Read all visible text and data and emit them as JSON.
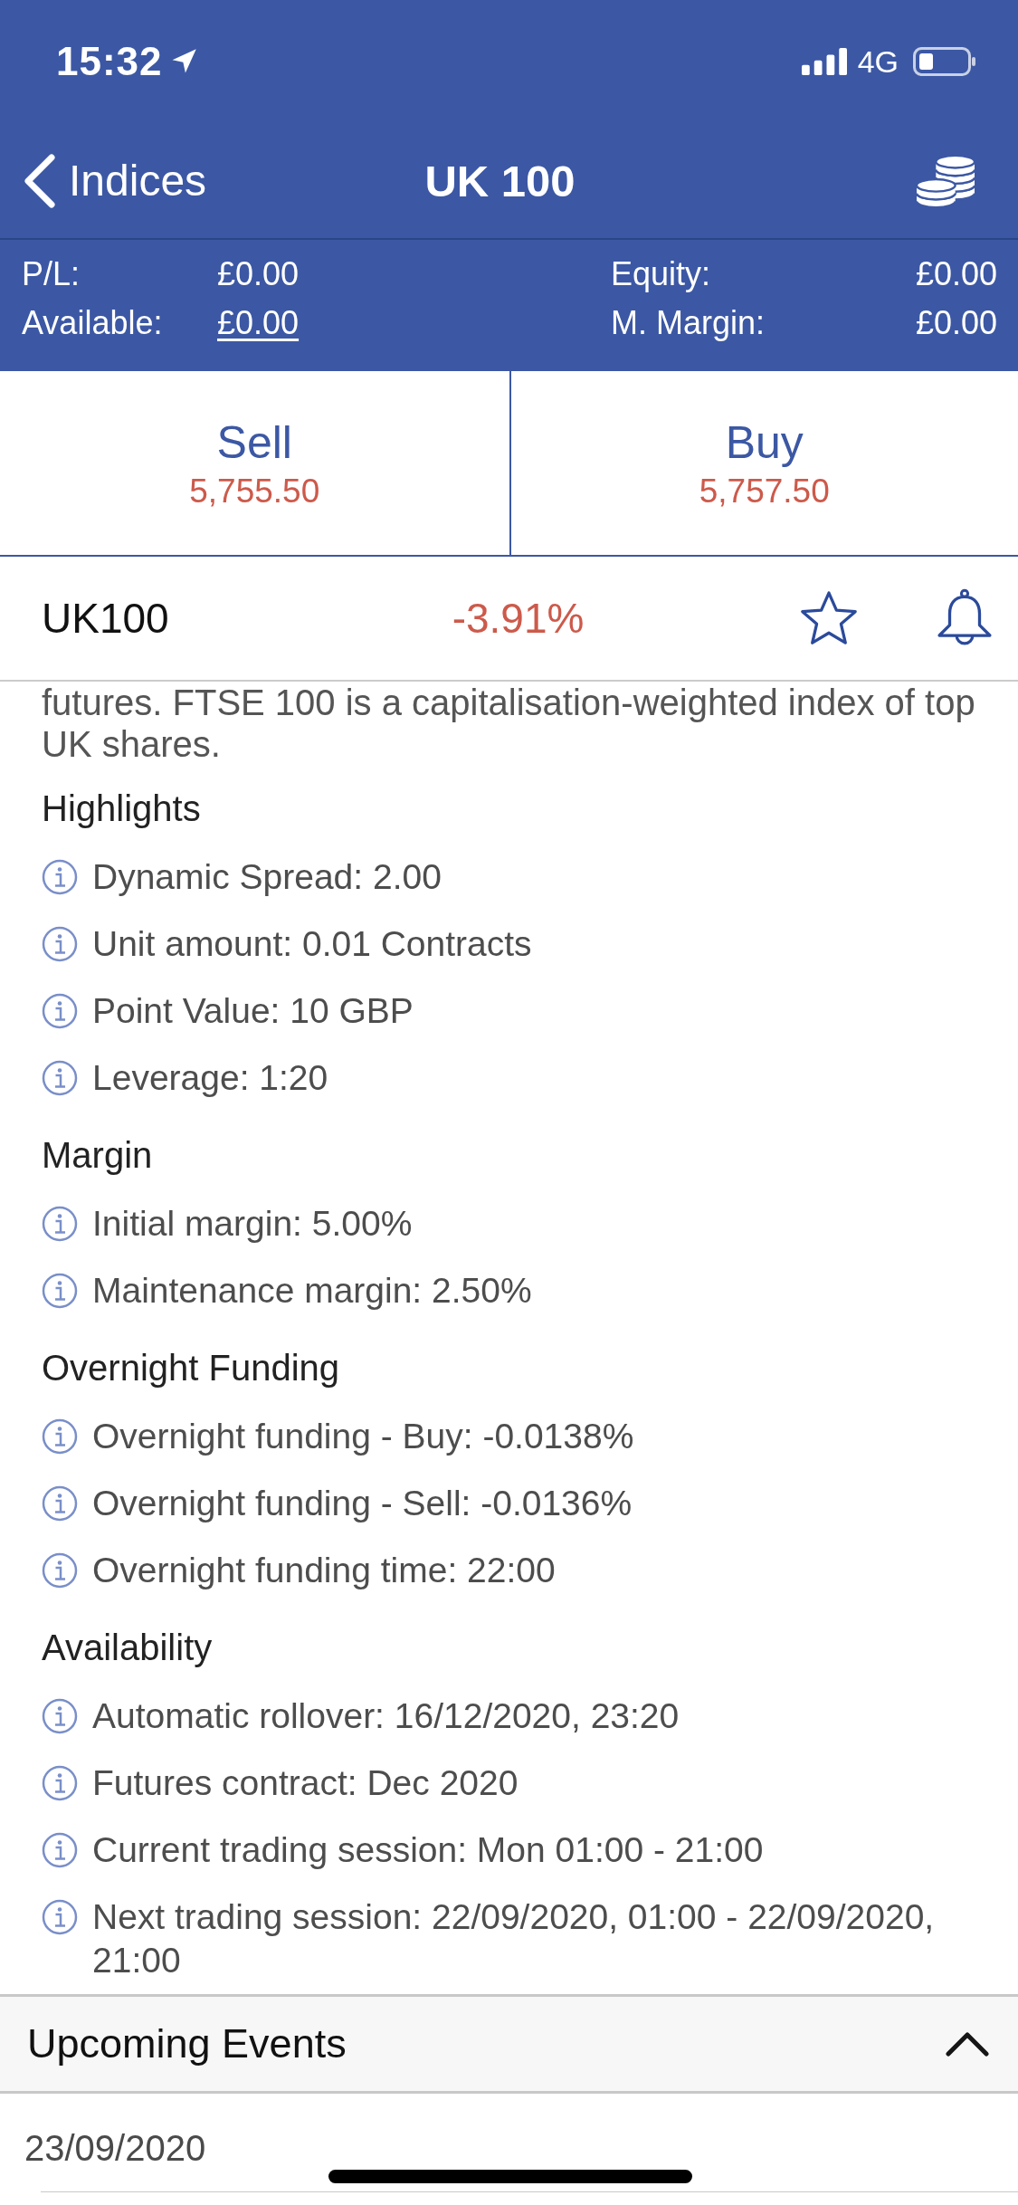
{
  "status_bar": {
    "time": "15:32",
    "network": "4G"
  },
  "nav": {
    "back_label": "Indices",
    "title": "UK 100"
  },
  "account": {
    "left": [
      {
        "label": "P/L:",
        "value": "£0.00",
        "link": false
      },
      {
        "label": "Available:",
        "value": "£0.00",
        "link": true
      }
    ],
    "right": [
      {
        "label": "Equity:",
        "value": "£0.00",
        "link": false
      },
      {
        "label": "M. Margin:",
        "value": "£0.00",
        "link": false
      }
    ]
  },
  "trade": [
    {
      "label": "Sell",
      "price": "5,755.50"
    },
    {
      "label": "Buy",
      "price": "5,757.50"
    }
  ],
  "instrument": {
    "symbol": "UK100",
    "change": "-3.91%",
    "favorite": false
  },
  "description": "futures. FTSE 100 is a capitalisation-weighted index of top UK shares.",
  "sections": [
    {
      "heading": "Highlights",
      "items": [
        "Dynamic Spread: 2.00",
        "Unit amount: 0.01 Contracts",
        "Point Value: 10 GBP",
        "Leverage: 1:20"
      ]
    },
    {
      "heading": "Margin",
      "items": [
        "Initial margin: 5.00%",
        "Maintenance margin: 2.50%"
      ]
    },
    {
      "heading": "Overnight Funding",
      "items": [
        "Overnight funding - Buy: -0.0138%",
        "Overnight funding - Sell: -0.0136%",
        "Overnight funding time: 22:00"
      ]
    },
    {
      "heading": "Availability",
      "items": [
        "Automatic rollover: 16/12/2020, 23:20",
        "Futures contract: Dec 2020",
        "Current trading session: Mon 01:00 - 21:00",
        "Next trading session: 22/09/2020, 01:00 - 22/09/2020, 21:00"
      ]
    }
  ],
  "upcoming_events": {
    "title": "Upcoming Events",
    "expanded": true,
    "dates": [
      "23/09/2020"
    ]
  }
}
